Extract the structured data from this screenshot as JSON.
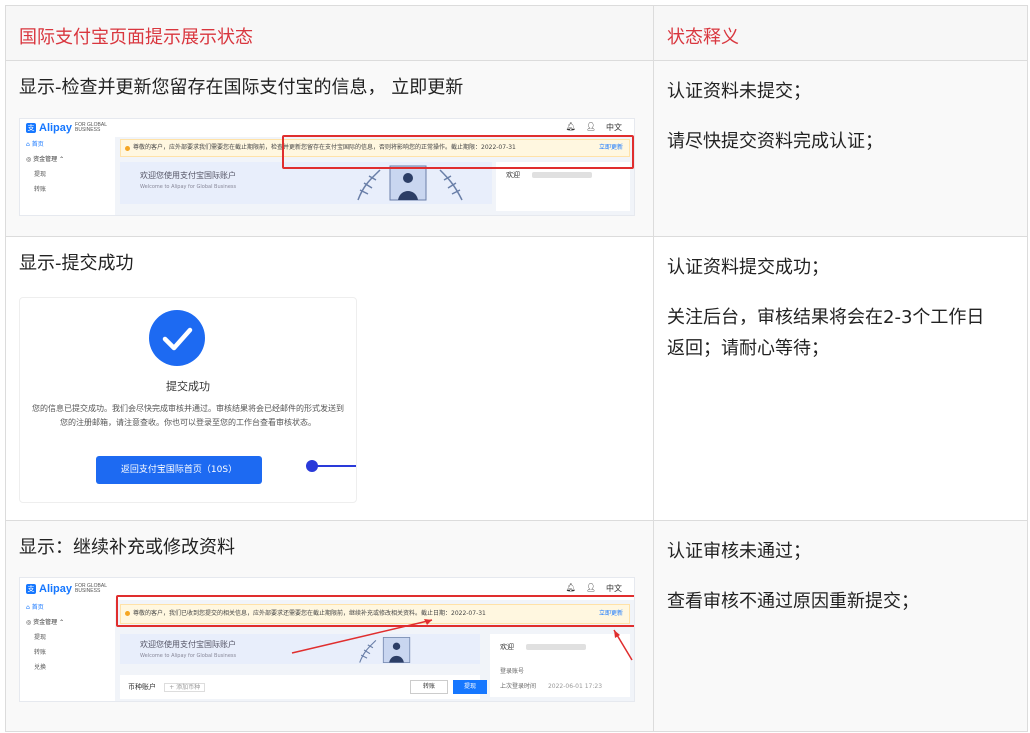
{
  "table": {
    "headers": [
      "国际支付宝页面提示展示状态",
      "状态释义"
    ],
    "rows": [
      {
        "title": "显示-检查并更新您留存在国际支付宝的信息， 立即更新",
        "desc": [
          "认证资料未提交；",
          "请尽快提交资料完成认证；"
        ]
      },
      {
        "title": "显示-提交成功",
        "desc": [
          "认证资料提交成功；",
          "关注后台，审核结果将会在2-3个工作日返回；请耐心等待；"
        ]
      },
      {
        "title": "显示：继续补充或修改资料",
        "desc": [
          "认证审核未通过；",
          "查看审核不通过原因重新提交；"
        ]
      }
    ]
  },
  "shot1": {
    "brand": "Alipay",
    "brand_for": "FOR GLOBAL BUSINESS",
    "top_lang": "中文",
    "side_items": [
      "首页",
      "资金管理",
      "提现",
      "转账"
    ],
    "banner_text": "尊敬的客户，应外部要求我们需要您在截止期限前，检查并更新您留存在支付宝国际的信息，否则将影响您的正常操作。截止期限：2022-07-31",
    "banner_link": "立即更新",
    "welcome_cn": "欢迎您使用支付宝国际账户",
    "welcome_en": "Welcome to Alipay for Global Business",
    "card_label": "欢迎"
  },
  "shot2": {
    "title": "提交成功",
    "body": "您的信息已提交成功。我们会尽快完成审核并通过。审核结果将会已经邮件的形式发送到您的注册邮箱，请注意查收。你也可以登录至您的工作台查看审核状态。",
    "button": "返回支付宝国际首页（10S）"
  },
  "shot3": {
    "brand": "Alipay",
    "brand_for": "FOR GLOBAL BUSINESS",
    "top_lang": "中文",
    "side_items": [
      "首页",
      "资金管理",
      "提现",
      "转账",
      "兑换"
    ],
    "banner_text": "尊敬的客户，我们已收到您提交的相关信息，应外部要求还需要您在截止期限前，继续补充或修改相关资料。截止日期：2022-07-31",
    "banner_link": "立即更新",
    "welcome_cn": "欢迎您使用支付宝国际账户",
    "welcome_en": "Welcome to Alipay for Global Business",
    "card_label": "欢迎",
    "card_rows": [
      "登录账号",
      "上次登录时间"
    ],
    "card_time": "2022-06-01 17:23",
    "account_label": "币种账户",
    "account_tag": "+ 添加币种",
    "btn_transfer": "转账",
    "btn_withdraw": "提现"
  }
}
